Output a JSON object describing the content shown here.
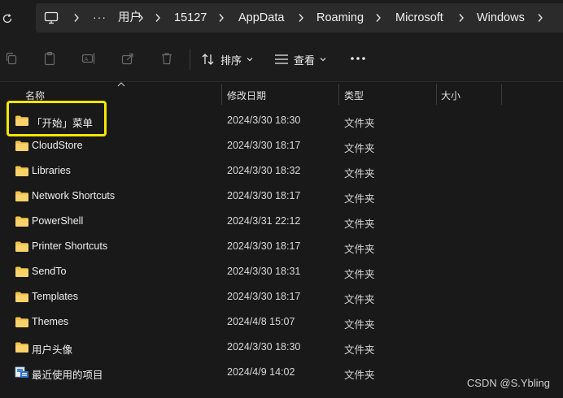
{
  "address": {
    "overflow": "···",
    "crumbs": [
      "用户",
      "15127",
      "AppData",
      "Roaming",
      "Microsoft",
      "Windows"
    ]
  },
  "toolbar": {
    "sort_label": "排序",
    "view_label": "查看",
    "more_label": "•••"
  },
  "columns": {
    "name": "名称",
    "date": "修改日期",
    "type": "类型",
    "size": "大小"
  },
  "files": [
    {
      "name": "「开始」菜单",
      "date": "2024/3/30 18:30",
      "type": "文件夹",
      "icon": "folder-icon"
    },
    {
      "name": "CloudStore",
      "date": "2024/3/30 18:17",
      "type": "文件夹",
      "icon": "folder-icon"
    },
    {
      "name": "Libraries",
      "date": "2024/3/30 18:32",
      "type": "文件夹",
      "icon": "folder-icon"
    },
    {
      "name": "Network Shortcuts",
      "date": "2024/3/30 18:17",
      "type": "文件夹",
      "icon": "folder-icon"
    },
    {
      "name": "PowerShell",
      "date": "2024/3/31 22:12",
      "type": "文件夹",
      "icon": "folder-icon"
    },
    {
      "name": "Printer Shortcuts",
      "date": "2024/3/30 18:17",
      "type": "文件夹",
      "icon": "folder-icon"
    },
    {
      "name": "SendTo",
      "date": "2024/3/30 18:31",
      "type": "文件夹",
      "icon": "folder-icon"
    },
    {
      "name": "Templates",
      "date": "2024/3/30 18:17",
      "type": "文件夹",
      "icon": "folder-icon"
    },
    {
      "name": "Themes",
      "date": "2024/4/8 15:07",
      "type": "文件夹",
      "icon": "folder-icon"
    },
    {
      "name": "用户头像",
      "date": "2024/3/30 18:30",
      "type": "文件夹",
      "icon": "folder-icon"
    },
    {
      "name": "最近使用的项目",
      "date": "2024/4/9 14:02",
      "type": "文件夹",
      "icon": "recent-items-icon"
    }
  ],
  "watermark": "CSDN @S.Ybling",
  "colors": {
    "background": "#191919",
    "folder": "#f3c24b",
    "highlight": "#f5e600"
  }
}
